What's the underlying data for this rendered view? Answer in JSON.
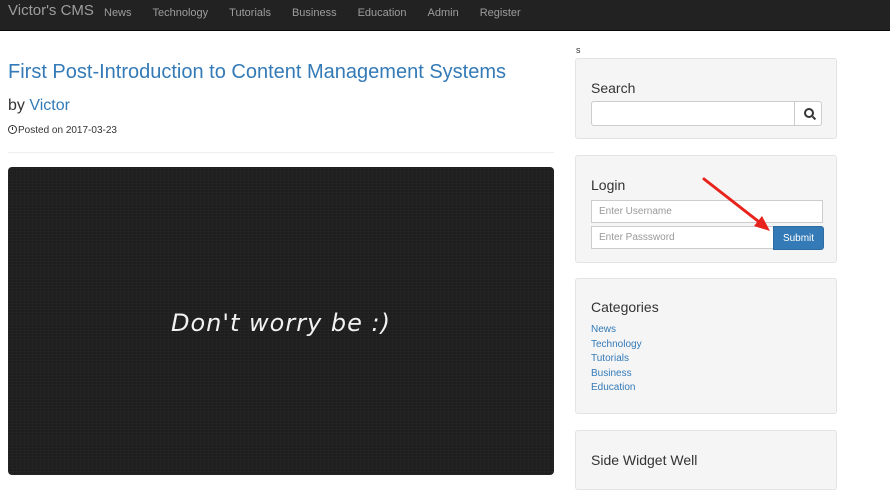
{
  "navbar": {
    "brand": "Victor's CMS",
    "links": [
      "News",
      "Technology",
      "Tutorials",
      "Business",
      "Education",
      "Admin",
      "Register"
    ]
  },
  "post": {
    "title": "First Post-Introduction to Content Management Systems",
    "by_prefix": "by",
    "author": "Victor",
    "posted_on": "Posted on 2017-03-23",
    "image_text": "Don't worry be :)"
  },
  "stray_text": "s",
  "sidebar": {
    "search": {
      "heading": "Search",
      "value": "",
      "placeholder": ""
    },
    "login": {
      "heading": "Login",
      "username_placeholder": "Enter Username",
      "password_placeholder": "Enter Passsword",
      "submit_label": "Submit"
    },
    "categories": {
      "heading": "Categories",
      "items": [
        "News",
        "Technology",
        "Tutorials",
        "Business",
        "Education"
      ]
    },
    "widget": {
      "heading": "Side Widget Well"
    }
  },
  "colors": {
    "navbar_bg": "#222222",
    "nav_text": "#9d9d9d",
    "link": "#337ab7",
    "well_bg": "#f5f5f5",
    "annotation_arrow": "#e8221c"
  },
  "icons": [
    "clock-icon",
    "search-icon",
    "annotation-arrow-icon"
  ]
}
